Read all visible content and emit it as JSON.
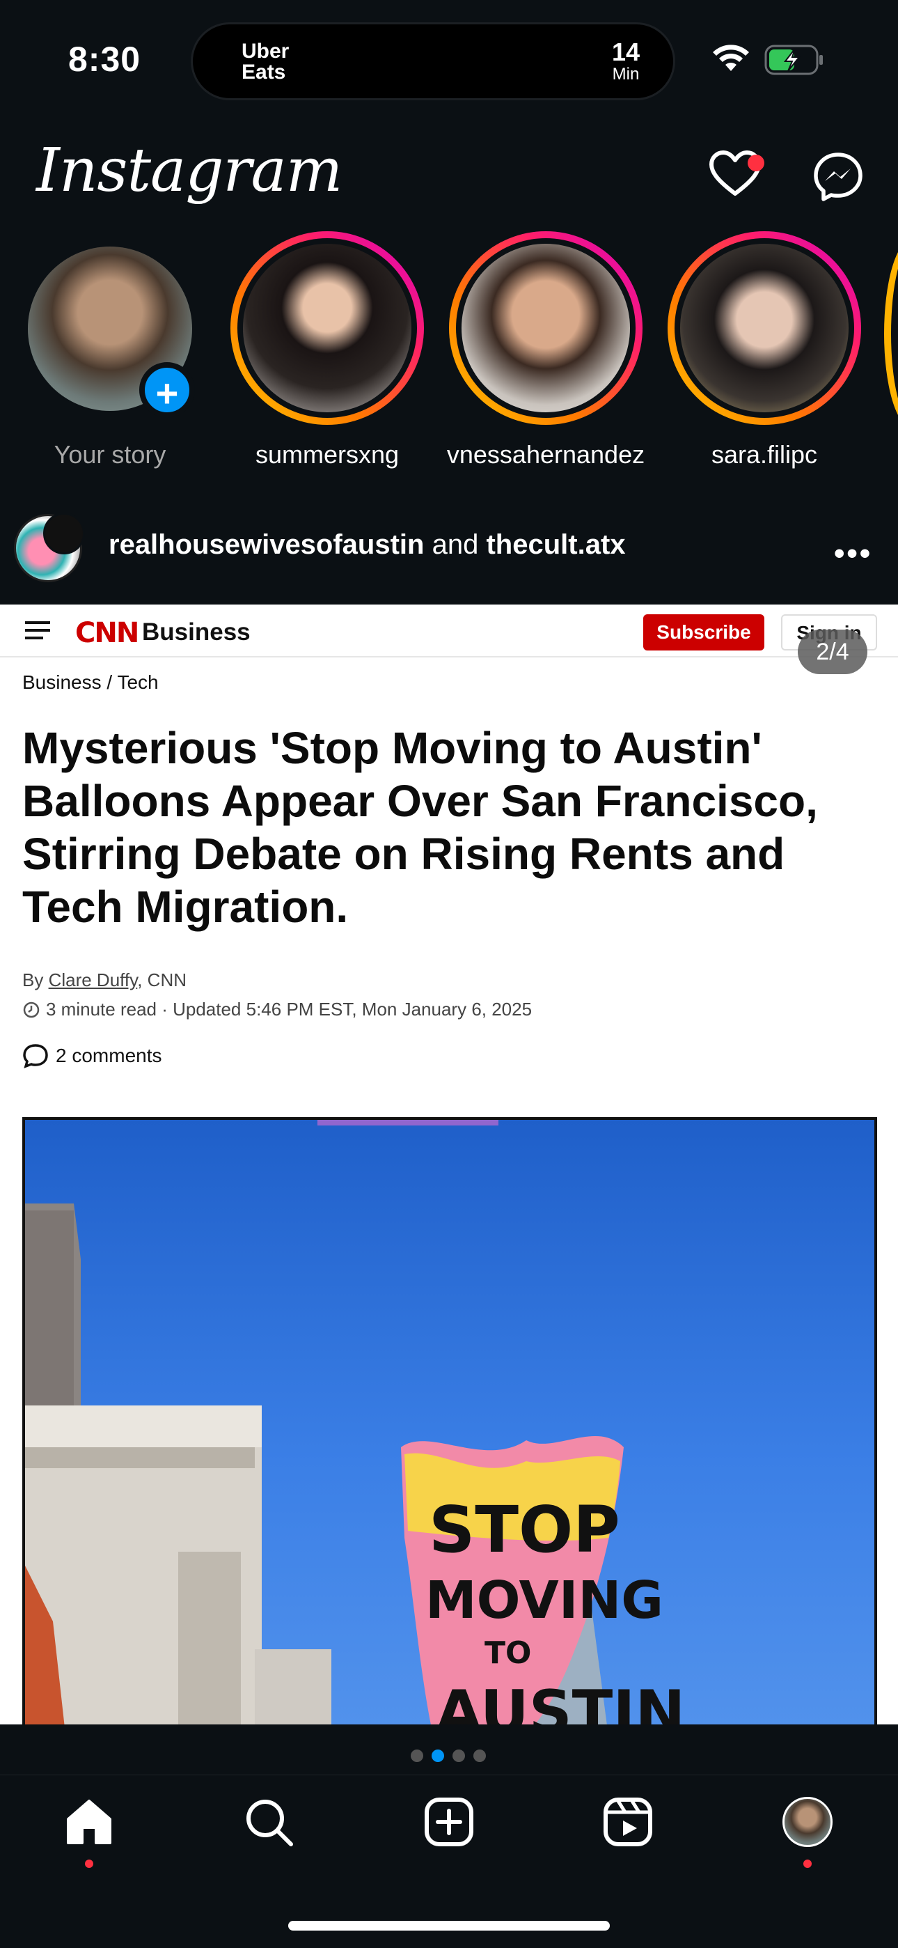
{
  "status_bar": {
    "time": "8:30",
    "island_app_line1": "Uber",
    "island_app_line2": "Eats",
    "island_value": "14",
    "island_unit": "Min"
  },
  "header": {
    "logo": "Instagram",
    "icons": [
      "heart-icon",
      "messenger-icon"
    ],
    "notification_dot_color": "#ff3040"
  },
  "stories": [
    {
      "label": "Your story",
      "own": true
    },
    {
      "label": "summersxng"
    },
    {
      "label": "vnessahernandez"
    },
    {
      "label": "sara.filipc"
    }
  ],
  "post": {
    "user1": "realhousewivesofaustin",
    "connector": "and",
    "user2": "thecult.atx",
    "page_counter": "2/4",
    "carousel": {
      "count": 4,
      "active_index": 1,
      "active_color": "#0095f6"
    }
  },
  "article": {
    "brand": "CNN",
    "section": "Business",
    "subscribe_label": "Subscribe",
    "signin_label": "Sign in",
    "breadcrumb": "Business  /  Tech",
    "headline": "Mysterious 'Stop Moving to Austin' Balloons Appear Over San Francisco, Stirring Debate on Rising Rents and Tech Migration.",
    "byline_prefix": "By ",
    "author": "Clare Duffy",
    "byline_suffix": ", CNN",
    "read_time": "3 minute read · Updated 5:46 PM EST, Mon January 6, 2025",
    "comments": "2 comments",
    "balloon_text": [
      "STOP",
      "MOVING",
      "TO",
      "AUSTIN"
    ]
  },
  "tab_bar": {
    "tabs": [
      "home-icon",
      "search-icon",
      "create-icon",
      "reels-icon",
      "profile-avatar"
    ],
    "active": "home-icon"
  }
}
